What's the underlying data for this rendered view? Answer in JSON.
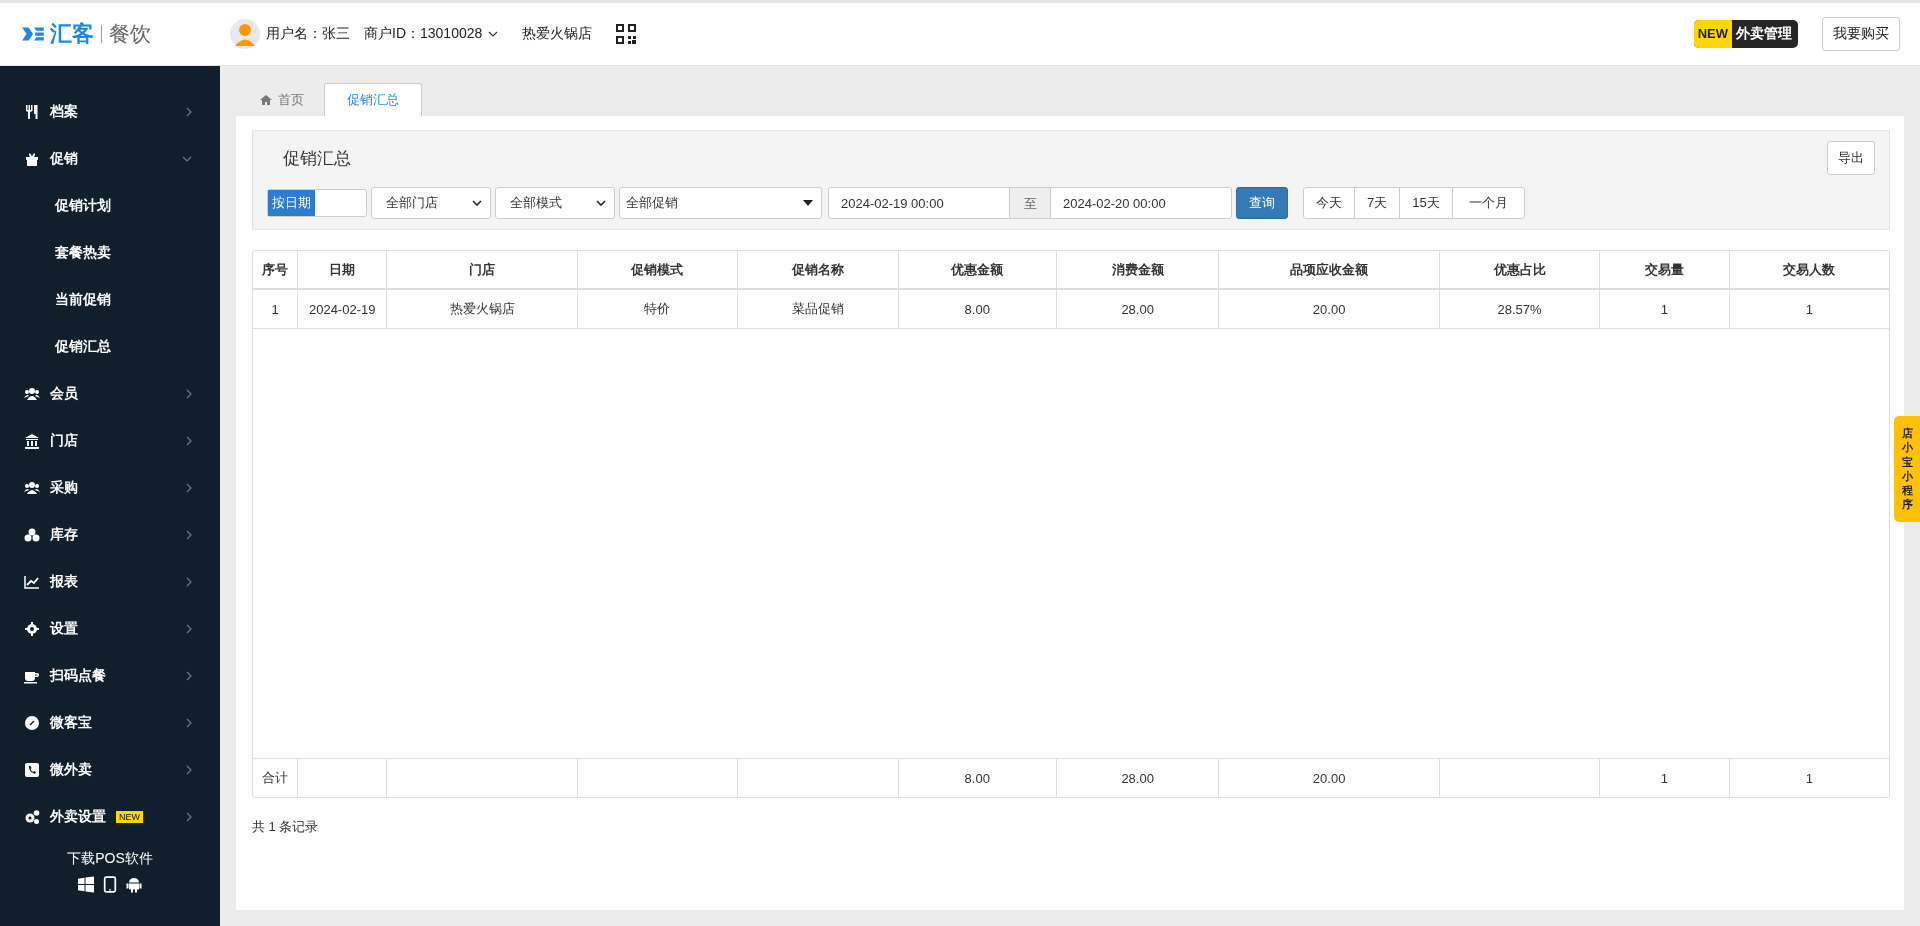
{
  "header": {
    "logo": {
      "brand": "汇客",
      "product": "餐饮"
    },
    "user_label": "用户名：张三",
    "merchant": "商户ID：13010028",
    "store": "热爱火锅店",
    "takeout": {
      "badge": "NEW",
      "label": "外卖管理"
    },
    "buy_button": "我要购买"
  },
  "sidebar": {
    "items": [
      {
        "label": "档案",
        "expanded": false
      },
      {
        "label": "促销",
        "expanded": true,
        "children": [
          {
            "label": "促销计划"
          },
          {
            "label": "套餐热卖"
          },
          {
            "label": "当前促销"
          },
          {
            "label": "促销汇总"
          }
        ]
      },
      {
        "label": "会员",
        "expanded": false
      },
      {
        "label": "门店",
        "expanded": false
      },
      {
        "label": "采购",
        "expanded": false
      },
      {
        "label": "库存",
        "expanded": false
      },
      {
        "label": "报表",
        "expanded": false
      },
      {
        "label": "设置",
        "expanded": false
      },
      {
        "label": "扫码点餐",
        "expanded": false
      },
      {
        "label": "微客宝",
        "expanded": false
      },
      {
        "label": "微外卖",
        "expanded": false
      },
      {
        "label": "外卖设置",
        "expanded": false,
        "badge": "NEW"
      }
    ],
    "download": "下载POS软件"
  },
  "tabs": [
    {
      "label": "首页",
      "selected": false
    },
    {
      "label": "促销汇总",
      "selected": true
    }
  ],
  "panel": {
    "title": "促销汇总",
    "export_button": "导出"
  },
  "filters": {
    "date_mode": {
      "label": "按日期",
      "on": true
    },
    "selects": [
      "全部门店",
      "全部模式",
      "全部促销"
    ],
    "date_from": "2024-02-19 00:00",
    "separator": "至",
    "date_to": "2024-02-20 00:00",
    "query_button": "查询",
    "quick_ranges": [
      "今天",
      "7天",
      "15天",
      "一个月"
    ]
  },
  "table": {
    "columns": [
      "序号",
      "日期",
      "门店",
      "促销模式",
      "促销名称",
      "优惠金额",
      "消费金额",
      "品项应收金额",
      "优惠占比",
      "交易量",
      "交易人数"
    ],
    "rows": [
      [
        "1",
        "2024-02-19",
        "热爱火锅店",
        "特价",
        "菜品促销",
        "8.00",
        "28.00",
        "20.00",
        "28.57%",
        "1",
        "1"
      ]
    ],
    "totals": {
      "label": "合计",
      "by_column": {
        "5": "8.00",
        "6": "28.00",
        "7": "20.00",
        "9": "1",
        "10": "1"
      }
    }
  },
  "record_count": "共 1 条记录",
  "side_tab": "店小宝小程序"
}
